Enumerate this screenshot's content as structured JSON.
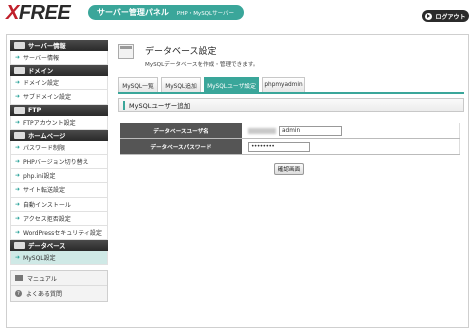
{
  "header": {
    "logo_x": "X",
    "logo_rest": "FREE",
    "panel_title": "サーバー管理パネル",
    "panel_subtitle": "PHP・MySQLサーバー",
    "logout_label": "ログアウト"
  },
  "sidebar": {
    "sections": [
      {
        "title": "サーバー情報",
        "items": [
          "サーバー情報"
        ]
      },
      {
        "title": "ドメイン",
        "items": [
          "ドメイン設定",
          "サブドメイン設定"
        ]
      },
      {
        "title": "FTP",
        "items": [
          "FTPアカウント設定"
        ]
      },
      {
        "title": "ホームページ",
        "items": [
          "パスワード制限",
          "PHPバージョン切り替え",
          "php.ini設定",
          "サイト転送設定",
          "自動インストール",
          "アクセス拒否設定",
          "WordPressセキュリティ設定"
        ]
      },
      {
        "title": "データベース",
        "items": [
          "MySQL設定"
        ]
      }
    ],
    "manual_label": "マニュアル",
    "faq_label": "よくある質問"
  },
  "main": {
    "title": "データベース設定",
    "subtitle": "MySQLデータベースを作成・管理できます。",
    "tabs": [
      "MySQL一覧",
      "MySQL追加",
      "MySQLユーザ設定",
      "phpmyadmin"
    ],
    "active_tab": "MySQLユーザ設定",
    "section_title": "MySQLユーザー追加",
    "form": {
      "user_label": "データベースユーザ名",
      "user_value": "admin",
      "pass_label": "データベースパスワード",
      "pass_value": "••••••••"
    },
    "confirm_label": "確認画面"
  },
  "colors": {
    "accent": "#3aa69a",
    "dark": "#2b2b2b",
    "logo_red": "#c0202b"
  }
}
